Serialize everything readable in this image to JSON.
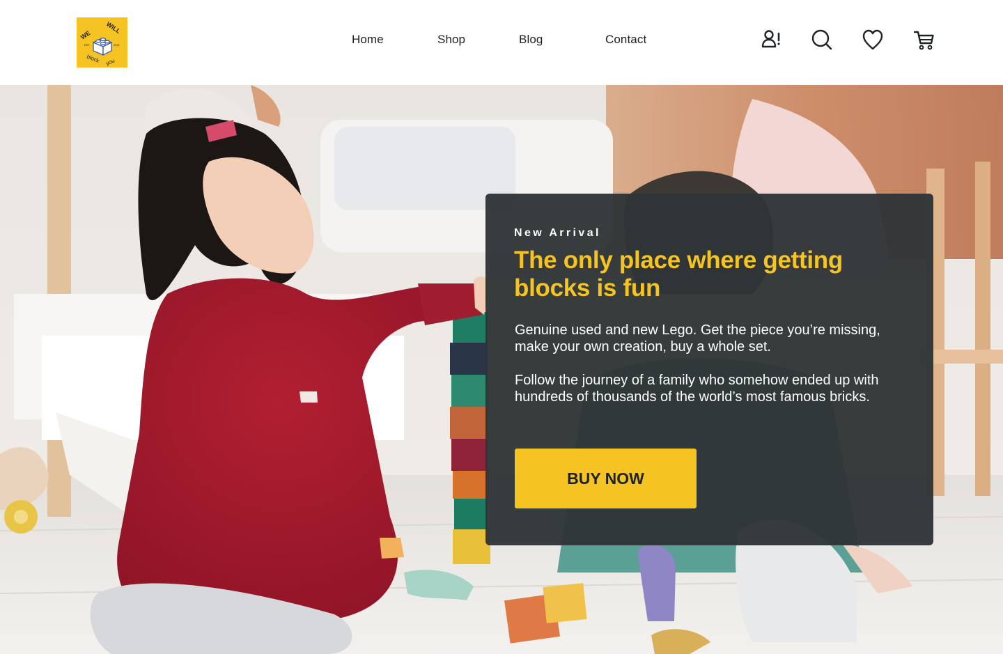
{
  "logo": {
    "alt": "We Will Block You logo",
    "brand_top": "WE WILL",
    "brand_bottom": "block you",
    "est": "EST.",
    "year": "2021"
  },
  "nav": {
    "items": [
      {
        "label": "Home"
      },
      {
        "label": "Shop"
      },
      {
        "label": "Blog"
      },
      {
        "label": "Contact"
      }
    ]
  },
  "header_icons": [
    "account-alert-icon",
    "search-icon",
    "heart-icon",
    "cart-icon"
  ],
  "hero": {
    "image_description": "Two children playing with colorful wooden blocks",
    "eyebrow": "New Arrival",
    "headline": "The only place where getting blocks is fun",
    "paragraph1": "Genuine used and new Lego. Get the piece you’re missing, make your own creation, buy a whole set.",
    "paragraph2": "Follow the journey of a family who somehow ended up with hundreds of thousands of the world’s most famous bricks.",
    "cta_label": "BUY NOW"
  },
  "colors": {
    "accent": "#f5c423",
    "card_bg": "#2f3436",
    "text_dark": "#222222",
    "dress_red": "#a3192c"
  }
}
